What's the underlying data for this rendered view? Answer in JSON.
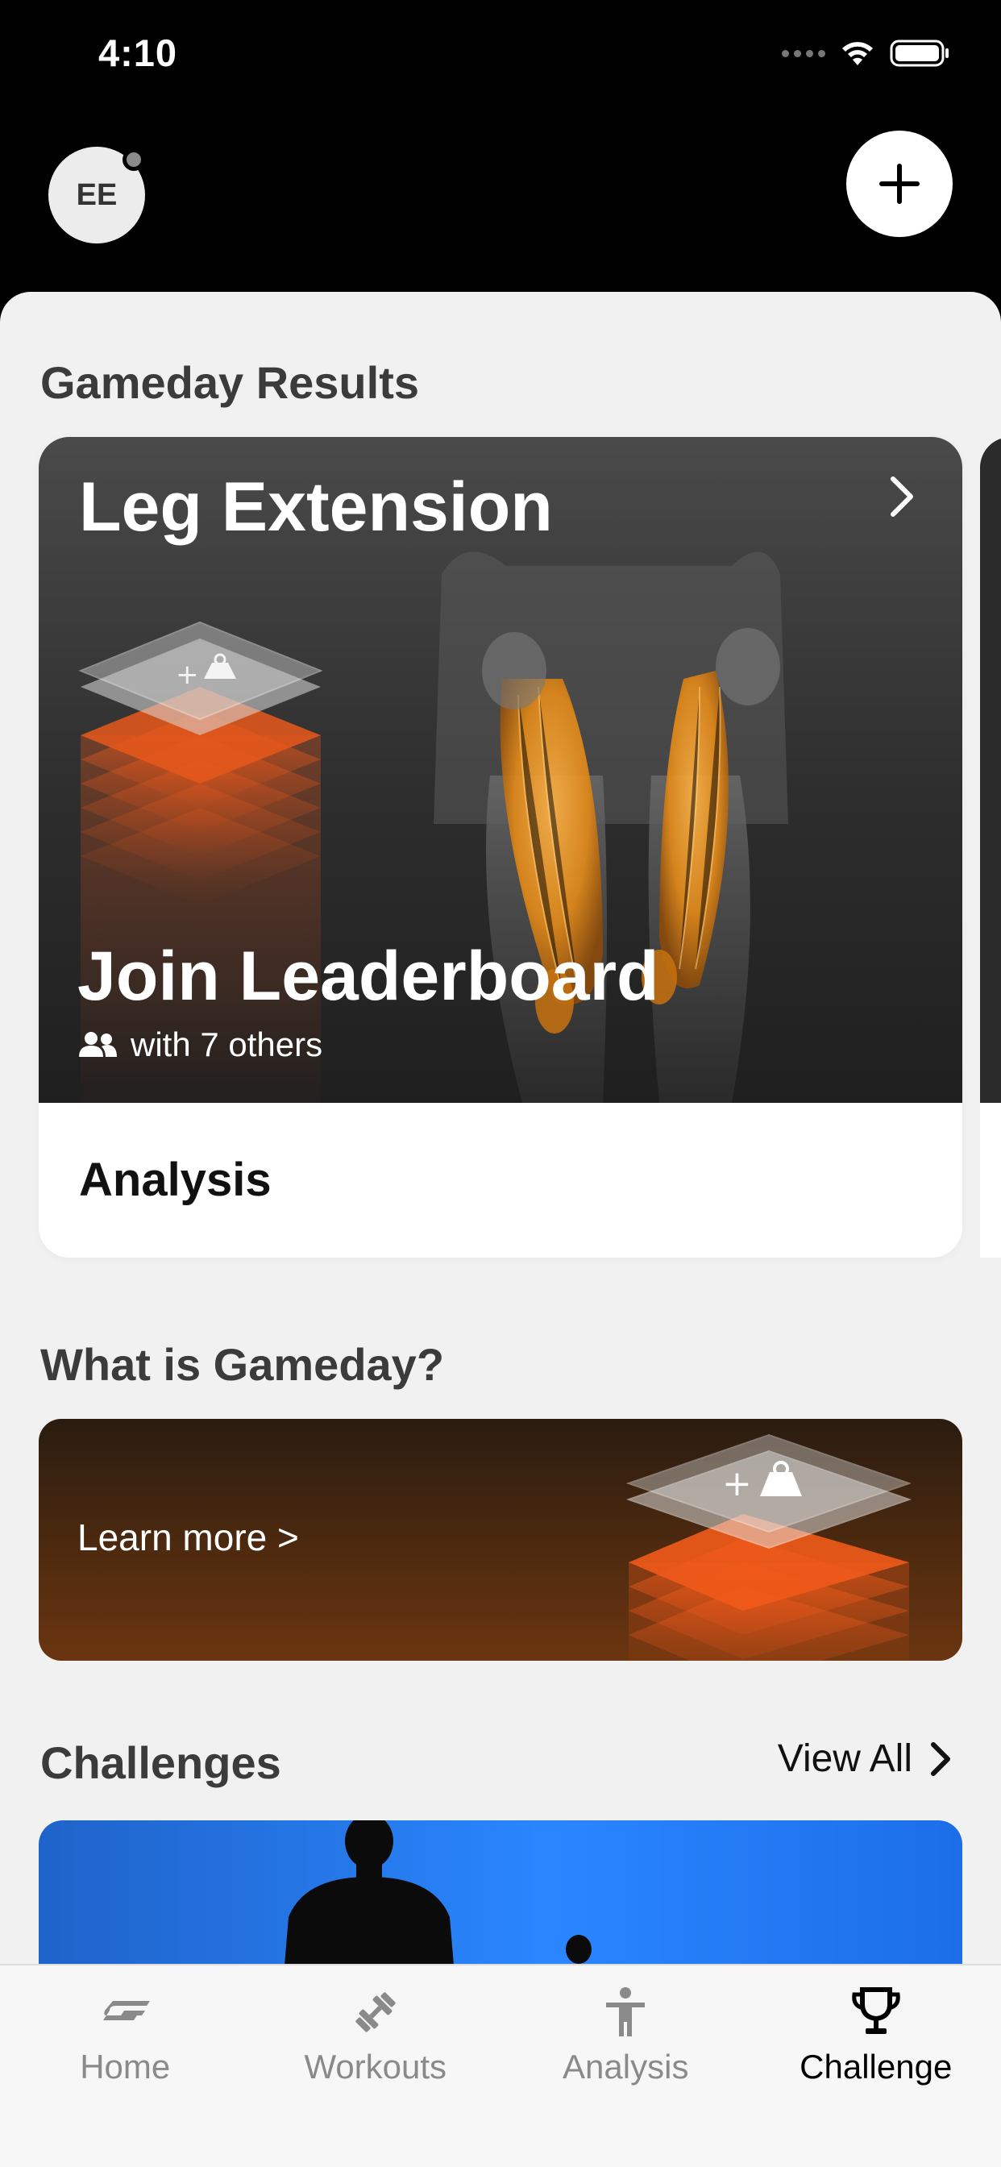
{
  "status_bar": {
    "time": "4:10"
  },
  "header": {
    "avatar_initials": "EE"
  },
  "gameday_results": {
    "section_title": "Gameday Results",
    "card": {
      "title": "Leg Extension",
      "cta": "Join Leaderboard",
      "participants": "with 7 others",
      "footer_label": "Analysis"
    }
  },
  "what_is_gameday": {
    "section_title": "What is Gameday?",
    "link_label": "Learn more >"
  },
  "challenges": {
    "section_title": "Challenges",
    "view_all_label": "View All"
  },
  "tab_bar": {
    "tabs": [
      {
        "label": "Home",
        "icon": "home-logo-icon",
        "active": false
      },
      {
        "label": "Workouts",
        "icon": "dumbbell-icon",
        "active": false
      },
      {
        "label": "Analysis",
        "icon": "person-icon",
        "active": false
      },
      {
        "label": "Challenge",
        "icon": "trophy-icon",
        "active": true
      }
    ]
  },
  "colors": {
    "accent_orange": "#f15a1a",
    "challenge_blue": "#2a86ff",
    "background": "#f1f1f1"
  }
}
